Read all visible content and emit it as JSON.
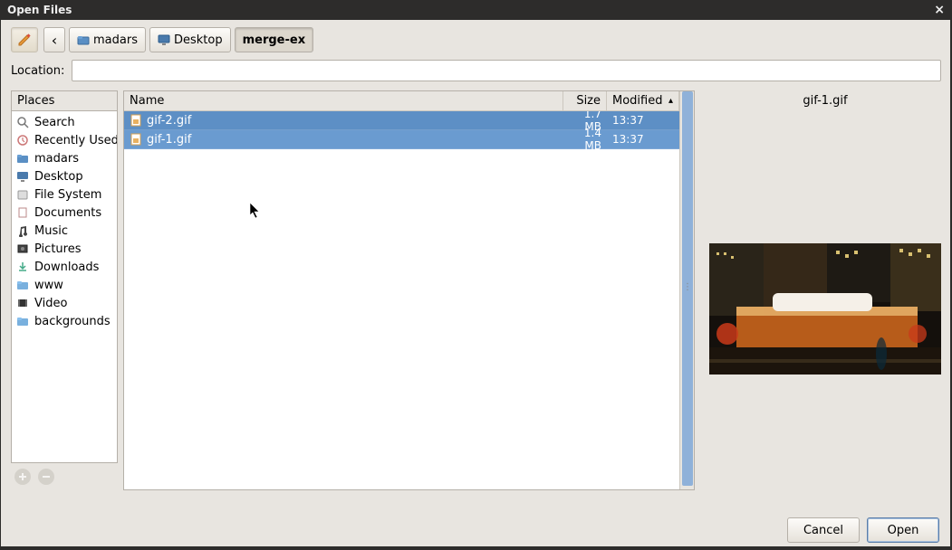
{
  "window": {
    "title": "Open Files"
  },
  "breadcrumbs": {
    "back": "‹",
    "items": [
      {
        "label": "madars",
        "icon": "folder-home"
      },
      {
        "label": "Desktop",
        "icon": "monitor"
      },
      {
        "label": "merge-ex",
        "icon": null,
        "active": true
      }
    ]
  },
  "location": {
    "label": "Location:",
    "value": ""
  },
  "sidebar": {
    "header": "Places",
    "items": [
      {
        "label": "Search",
        "icon": "search"
      },
      {
        "label": "Recently Used",
        "icon": "recent"
      },
      {
        "label": "madars",
        "icon": "folder-home"
      },
      {
        "label": "Desktop",
        "icon": "monitor"
      },
      {
        "label": "File System",
        "icon": "disk"
      },
      {
        "label": "Documents",
        "icon": "documents"
      },
      {
        "label": "Music",
        "icon": "music"
      },
      {
        "label": "Pictures",
        "icon": "pictures"
      },
      {
        "label": "Downloads",
        "icon": "downloads"
      },
      {
        "label": "www",
        "icon": "folder"
      },
      {
        "label": "Video",
        "icon": "video"
      },
      {
        "label": "backgrounds",
        "icon": "folder"
      }
    ]
  },
  "files": {
    "columns": {
      "name": "Name",
      "size": "Size",
      "modified": "Modified"
    },
    "sort": {
      "column": "modified",
      "dir": "asc"
    },
    "rows": [
      {
        "name": "gif-2.gif",
        "size": "1.7 MB",
        "modified": "13:37",
        "selected": true
      },
      {
        "name": "gif-1.gif",
        "size": "1.4 MB",
        "modified": "13:37",
        "selected": true
      }
    ]
  },
  "preview": {
    "filename": "gif-1.gif"
  },
  "buttons": {
    "cancel": "Cancel",
    "open": "Open"
  }
}
